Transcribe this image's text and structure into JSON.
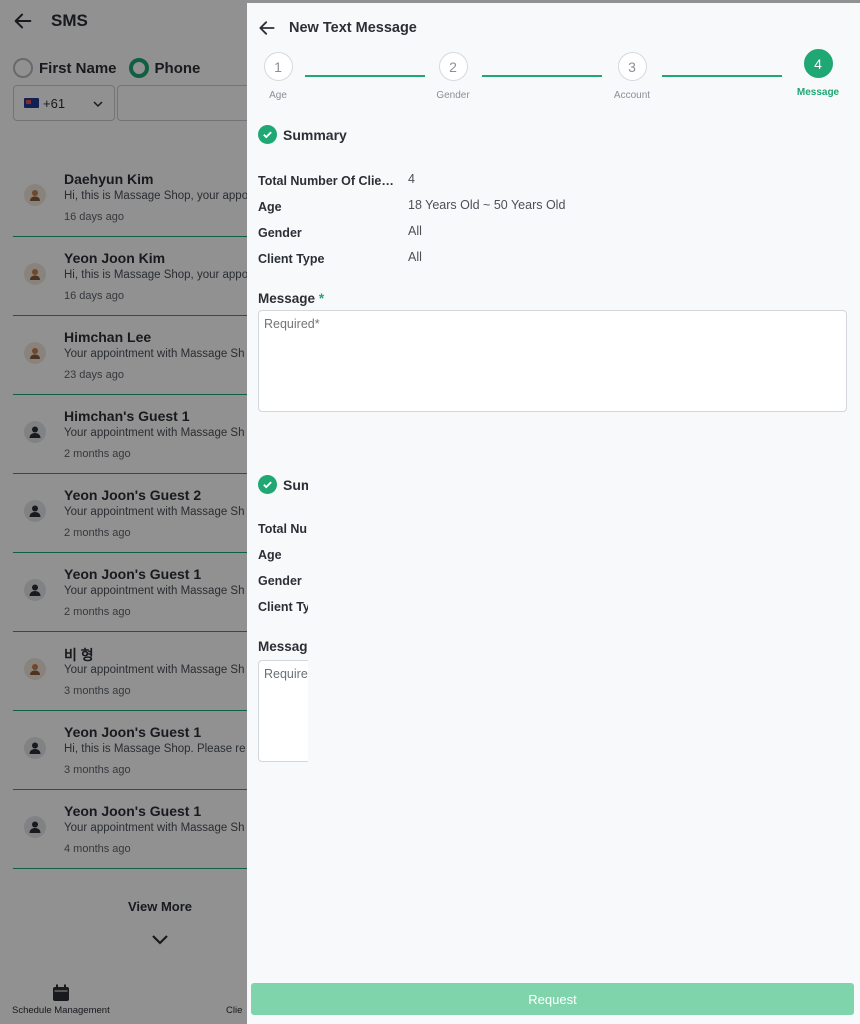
{
  "background": {
    "title": "SMS",
    "radio_options": [
      {
        "label": "First Name",
        "selected": false
      },
      {
        "label": "Phone",
        "selected": true
      }
    ],
    "country_code": "+61",
    "messages": [
      {
        "name": "Daehyun Kim",
        "preview": "Hi, this is Massage Shop, your appoi",
        "time": "16 days ago",
        "avatar": "photo"
      },
      {
        "name": "Yeon Joon Kim",
        "preview": "Hi, this is Massage Shop, your appoi",
        "time": "16 days ago",
        "avatar": "photo"
      },
      {
        "name": "Himchan Lee",
        "preview": "Your appointment with Massage Sh",
        "time": "23 days ago",
        "avatar": "photo"
      },
      {
        "name": "Himchan's Guest 1",
        "preview": "Your appointment with Massage Sh",
        "time": "2 months ago",
        "avatar": "person"
      },
      {
        "name": "Yeon Joon's Guest 2",
        "preview": "Your appointment with Massage Sh",
        "time": "2 months ago",
        "avatar": "person"
      },
      {
        "name": "Yeon Joon's Guest 1",
        "preview": "Your appointment with Massage Sh",
        "time": "2 months ago",
        "avatar": "person"
      },
      {
        "name": "비 형",
        "preview": "Your appointment with Massage Sh",
        "time": "3 months ago",
        "avatar": "photo"
      },
      {
        "name": "Yeon Joon's Guest 1",
        "preview": "Hi, this is Massage Shop. Please re",
        "time": "3 months ago",
        "avatar": "person"
      },
      {
        "name": "Yeon Joon's Guest 1",
        "preview": "Your appointment with Massage Sh",
        "time": "4 months ago",
        "avatar": "person"
      }
    ],
    "view_more": "View More",
    "bottom_nav": [
      {
        "label": "Schedule Management",
        "icon": "calendar-icon"
      },
      {
        "label": "Clie",
        "icon": "client-icon"
      }
    ]
  },
  "panel": {
    "title": "New Text Message",
    "steps": [
      {
        "number": "1",
        "label": "Age",
        "active": false
      },
      {
        "number": "2",
        "label": "Gender",
        "active": false
      },
      {
        "number": "3",
        "label": "Account",
        "active": false
      },
      {
        "number": "4",
        "label": "Message",
        "active": true
      }
    ],
    "summary": {
      "title": "Summary",
      "rows": [
        {
          "label": "Total Number Of Clients",
          "value": "4"
        },
        {
          "label": "Age",
          "value": "18 Years Old ~ 50 Years Old"
        },
        {
          "label": "Gender",
          "value": "All"
        },
        {
          "label": "Client Type",
          "value": "All"
        }
      ]
    },
    "message_label": "Message",
    "required_marker": "*",
    "message_placeholder": "Required*",
    "request_button": "Request"
  },
  "colors": {
    "accent": "#1fa774",
    "button_disabled": "#7fd4ac",
    "overlay": "rgba(0,0,0,0.43)"
  }
}
